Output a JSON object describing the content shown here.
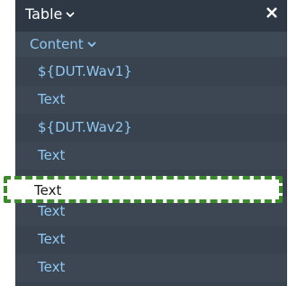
{
  "header": {
    "title": "Table",
    "close_icon": "close-icon",
    "chevron_icon": "chevron-down-icon"
  },
  "section": {
    "title": "Content"
  },
  "items": [
    {
      "label": "${DUT.Wav1}"
    },
    {
      "label": "Text"
    },
    {
      "label": "${DUT.Wav2}"
    },
    {
      "label": "Text"
    },
    {
      "label": "Text"
    },
    {
      "label": "Text"
    },
    {
      "label": "Text"
    },
    {
      "label": "Text"
    }
  ],
  "selected_index": 4,
  "colors": {
    "panel_bg": "#38434f",
    "header_bg": "#2d3844",
    "item_text": "#8fc8f2",
    "highlight_border": "#3b8a2c"
  }
}
